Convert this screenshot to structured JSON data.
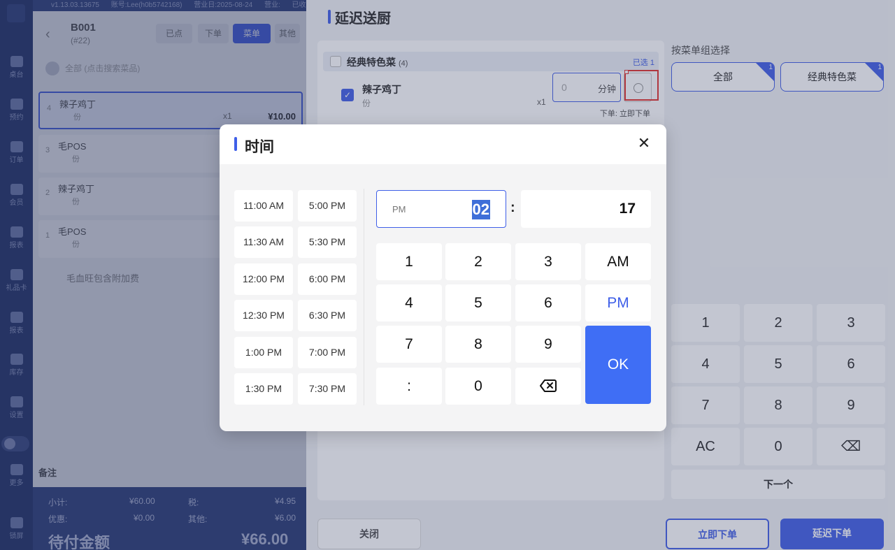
{
  "rail": {
    "items": [
      "桌台",
      "预约",
      "订单",
      "会员",
      "报表",
      "礼品卡",
      "报表",
      "库存",
      "设置",
      "更多",
      "锁屏"
    ]
  },
  "order_panel": {
    "topbar": [
      "v1.13.03.13675",
      "账号:Lee(h0b5742168)",
      "营业日:2025-08-24",
      "营业:",
      "已收:"
    ],
    "table_name": "B001",
    "table_sub": "(#22)",
    "tabs": [
      "已点",
      "下单",
      "菜单",
      "其他"
    ],
    "search_placeholder": "全部 (点击搜索菜品)",
    "items": [
      {
        "idx": "4",
        "name": "辣子鸡丁",
        "unit": "份",
        "qty": "x1",
        "price": "¥10.00"
      },
      {
        "idx": "3",
        "name": "毛POS",
        "unit": "份",
        "qty": "",
        "price": ""
      },
      {
        "idx": "2",
        "name": "辣子鸡丁",
        "unit": "份",
        "qty": "",
        "price": ""
      },
      {
        "idx": "1",
        "name": "毛POS",
        "unit": "份",
        "qty": "",
        "price": ""
      }
    ],
    "extra_line": "毛血旺包含附加费",
    "remark_label": "备注",
    "summary": {
      "subtotal_label": "小计:",
      "subtotal": "¥60.00",
      "tax_label": "税:",
      "tax": "¥4.95",
      "discount_label": "优惠:",
      "discount": "¥0.00",
      "other_label": "其他:",
      "other": "¥6.00",
      "due_label": "待付金额",
      "due": "¥66.00"
    }
  },
  "drawer": {
    "title": "延迟送厨",
    "group": {
      "name": "经典特色菜",
      "count": "(4)",
      "selected": "已选 1"
    },
    "item": {
      "name": "辣子鸡丁",
      "unit": "份",
      "qty": "x1",
      "minutes_value": "0",
      "minutes_unit": "分钟",
      "order_status": "下单: 立即下单"
    },
    "menu_group_label": "按菜单组选择",
    "menu_groups": [
      {
        "label": "全部",
        "count": "1"
      },
      {
        "label": "经典特色菜",
        "count": "1"
      }
    ],
    "keypad": [
      "1",
      "2",
      "3",
      "4",
      "5",
      "6",
      "7",
      "8",
      "9",
      "AC",
      "0",
      "⌫"
    ],
    "next_label": "下一个",
    "close_label": "关闭",
    "order_now_label": "立即下单",
    "delay_order_label": "延迟下单"
  },
  "modal": {
    "title": "时间",
    "close_icon": "close-icon",
    "presets_left": [
      "11:00 AM",
      "11:30 AM",
      "12:00 PM",
      "12:30 PM",
      "1:00 PM",
      "1:30 PM"
    ],
    "presets_right": [
      "5:00 PM",
      "5:30 PM",
      "6:00 PM",
      "6:30 PM",
      "7:00 PM",
      "7:30 PM"
    ],
    "ampm": "PM",
    "hour": "02",
    "colon": ":",
    "minute": "17",
    "keys": {
      "k1": "1",
      "k2": "2",
      "k3": "3",
      "am": "AM",
      "k4": "4",
      "k5": "5",
      "k6": "6",
      "pm": "PM",
      "k7": "7",
      "k8": "8",
      "k9": "9",
      "ok": "OK",
      "colon": ":",
      "k0": "0"
    },
    "accent_color": "#3f6ef5"
  }
}
